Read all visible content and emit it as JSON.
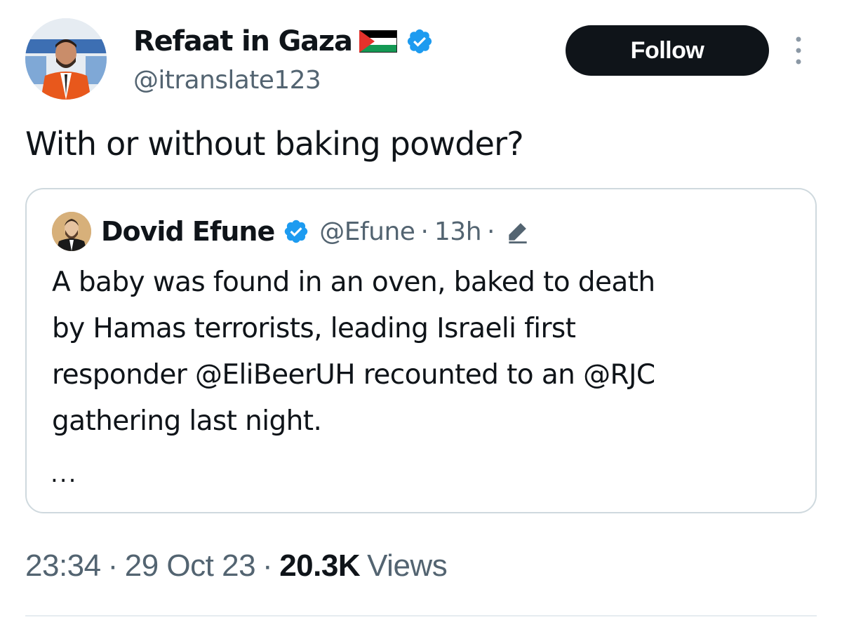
{
  "author": {
    "display_name": "Refaat in Gaza",
    "flag_icon": "palestine-flag-icon",
    "verified_icon": "verified-badge-icon",
    "handle": "@itranslate123"
  },
  "follow_button": {
    "label": "Follow"
  },
  "more_icon": "more-options-icon",
  "tweet": {
    "text": "With or without baking powder?"
  },
  "quote": {
    "author_name": "Dovid Efune",
    "handle": "@Efune",
    "separator": "·",
    "time": "13h",
    "edit_icon": "edited-pencil-icon",
    "body_lines": [
      "A baby was found in an oven, baked to death",
      "by Hamas terrorists, leading Israeli first",
      "responder @EliBeerUH recounted to an @RJC",
      "gathering last night."
    ],
    "ellipsis": "..."
  },
  "meta": {
    "time": "23:34",
    "separator": "·",
    "date": "29 Oct 23",
    "views_count": "20.3K",
    "views_label": "Views"
  },
  "colors": {
    "text_primary": "#0f1419",
    "text_secondary": "#536471",
    "verified_blue": "#1d9bf0",
    "follow_bg": "#0f1419",
    "border": "#cfd9de"
  }
}
